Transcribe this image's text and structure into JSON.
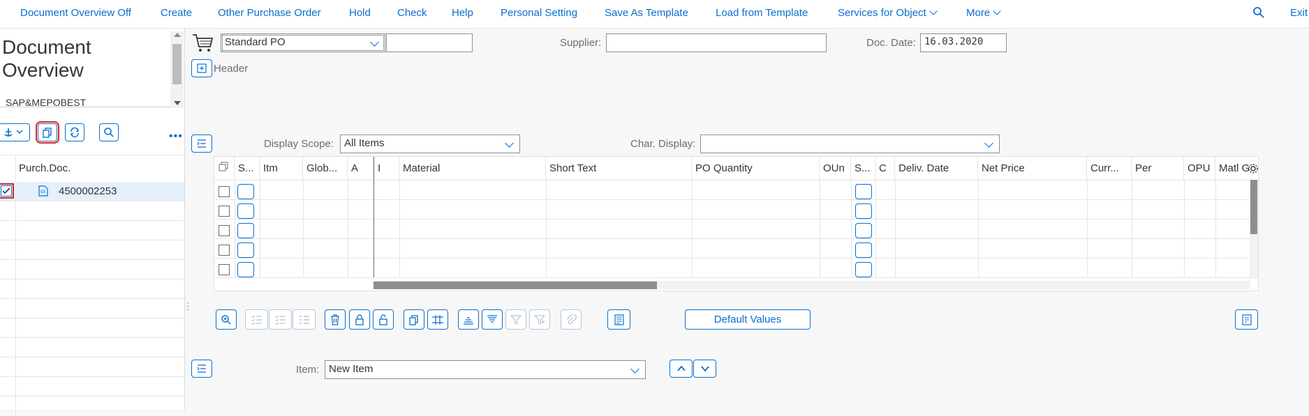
{
  "menu": [
    {
      "label": "Document Overview Off"
    },
    {
      "label": "Create"
    },
    {
      "label": "Other Purchase Order"
    },
    {
      "label": "Hold"
    },
    {
      "label": "Check"
    },
    {
      "label": "Help"
    },
    {
      "label": "Personal Setting"
    },
    {
      "label": "Save As Template"
    },
    {
      "label": "Load from Template"
    },
    {
      "label": "Services for Object"
    },
    {
      "label": "More"
    },
    {
      "label": "Exit"
    }
  ],
  "left_panel": {
    "title": "Document Overview",
    "variant": "SAP&MEPOBEST",
    "tree_header": "Purch.Doc.",
    "tree_rows": [
      {
        "label": "4500002253",
        "checked": true
      }
    ]
  },
  "header": {
    "po_type": "Standard PO",
    "po_number": "",
    "supplier_label": "Supplier:",
    "supplier_value": "",
    "doc_date_label": "Doc. Date:",
    "doc_date_value": "16.03.2020",
    "header_label": "Header"
  },
  "items": {
    "display_scope_label": "Display Scope:",
    "display_scope_value": "All Items",
    "char_display_label": "Char. Display:",
    "char_display_value": "",
    "columns": [
      "S...",
      "Itm",
      "Glob...",
      "A",
      "I",
      "Material",
      "Short Text",
      "PO Quantity",
      "OUn",
      "S...",
      "C",
      "Deliv. Date",
      "Net Price",
      "Curr...",
      "Per",
      "OPU",
      "Matl Gr"
    ],
    "row_count": 5,
    "default_values_label": "Default Values"
  },
  "item_detail": {
    "item_label": "Item:",
    "item_value": "New Item"
  },
  "colors": {
    "accent": "#0a6ed1",
    "highlight": "#e32424",
    "selected_row": "#e5f0fa"
  }
}
